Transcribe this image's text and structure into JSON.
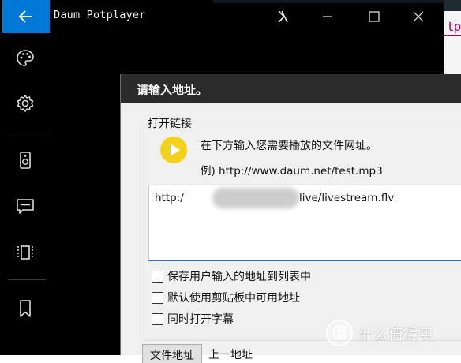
{
  "app": {
    "title": "Daum Potplayer"
  },
  "sidebar": {
    "items": [
      {
        "icon": "palette-icon"
      },
      {
        "icon": "gear-icon"
      },
      {
        "icon": "speaker-icon"
      },
      {
        "icon": "subtitle-icon"
      },
      {
        "icon": "screen-icon"
      },
      {
        "icon": "bookmark-icon"
      }
    ]
  },
  "background_editor": {
    "fragment": "tp"
  },
  "dialog": {
    "title": "请输入地址。",
    "group_label": "打开链接",
    "hint": "在下方输入您需要播放的文件网址。",
    "example": "例) http://www.daum.net/test.mp3",
    "url_prefix": "http:/",
    "url_suffix": "live/livestream.flv",
    "checkboxes": [
      {
        "label": "保存用户输入的地址到列表中",
        "checked": false
      },
      {
        "label": "默认使用剪贴板中可用地址",
        "checked": false
      },
      {
        "label": "同时打开字幕",
        "checked": false
      }
    ],
    "buttons": {
      "file_address": "文件地址",
      "previous_address": "上一地址"
    }
  },
  "watermark": {
    "text": "什么值得买"
  },
  "colors": {
    "accent": "#0078d7",
    "play_yellow": "#f5d21a",
    "input_focus": "#2f6fd1"
  }
}
